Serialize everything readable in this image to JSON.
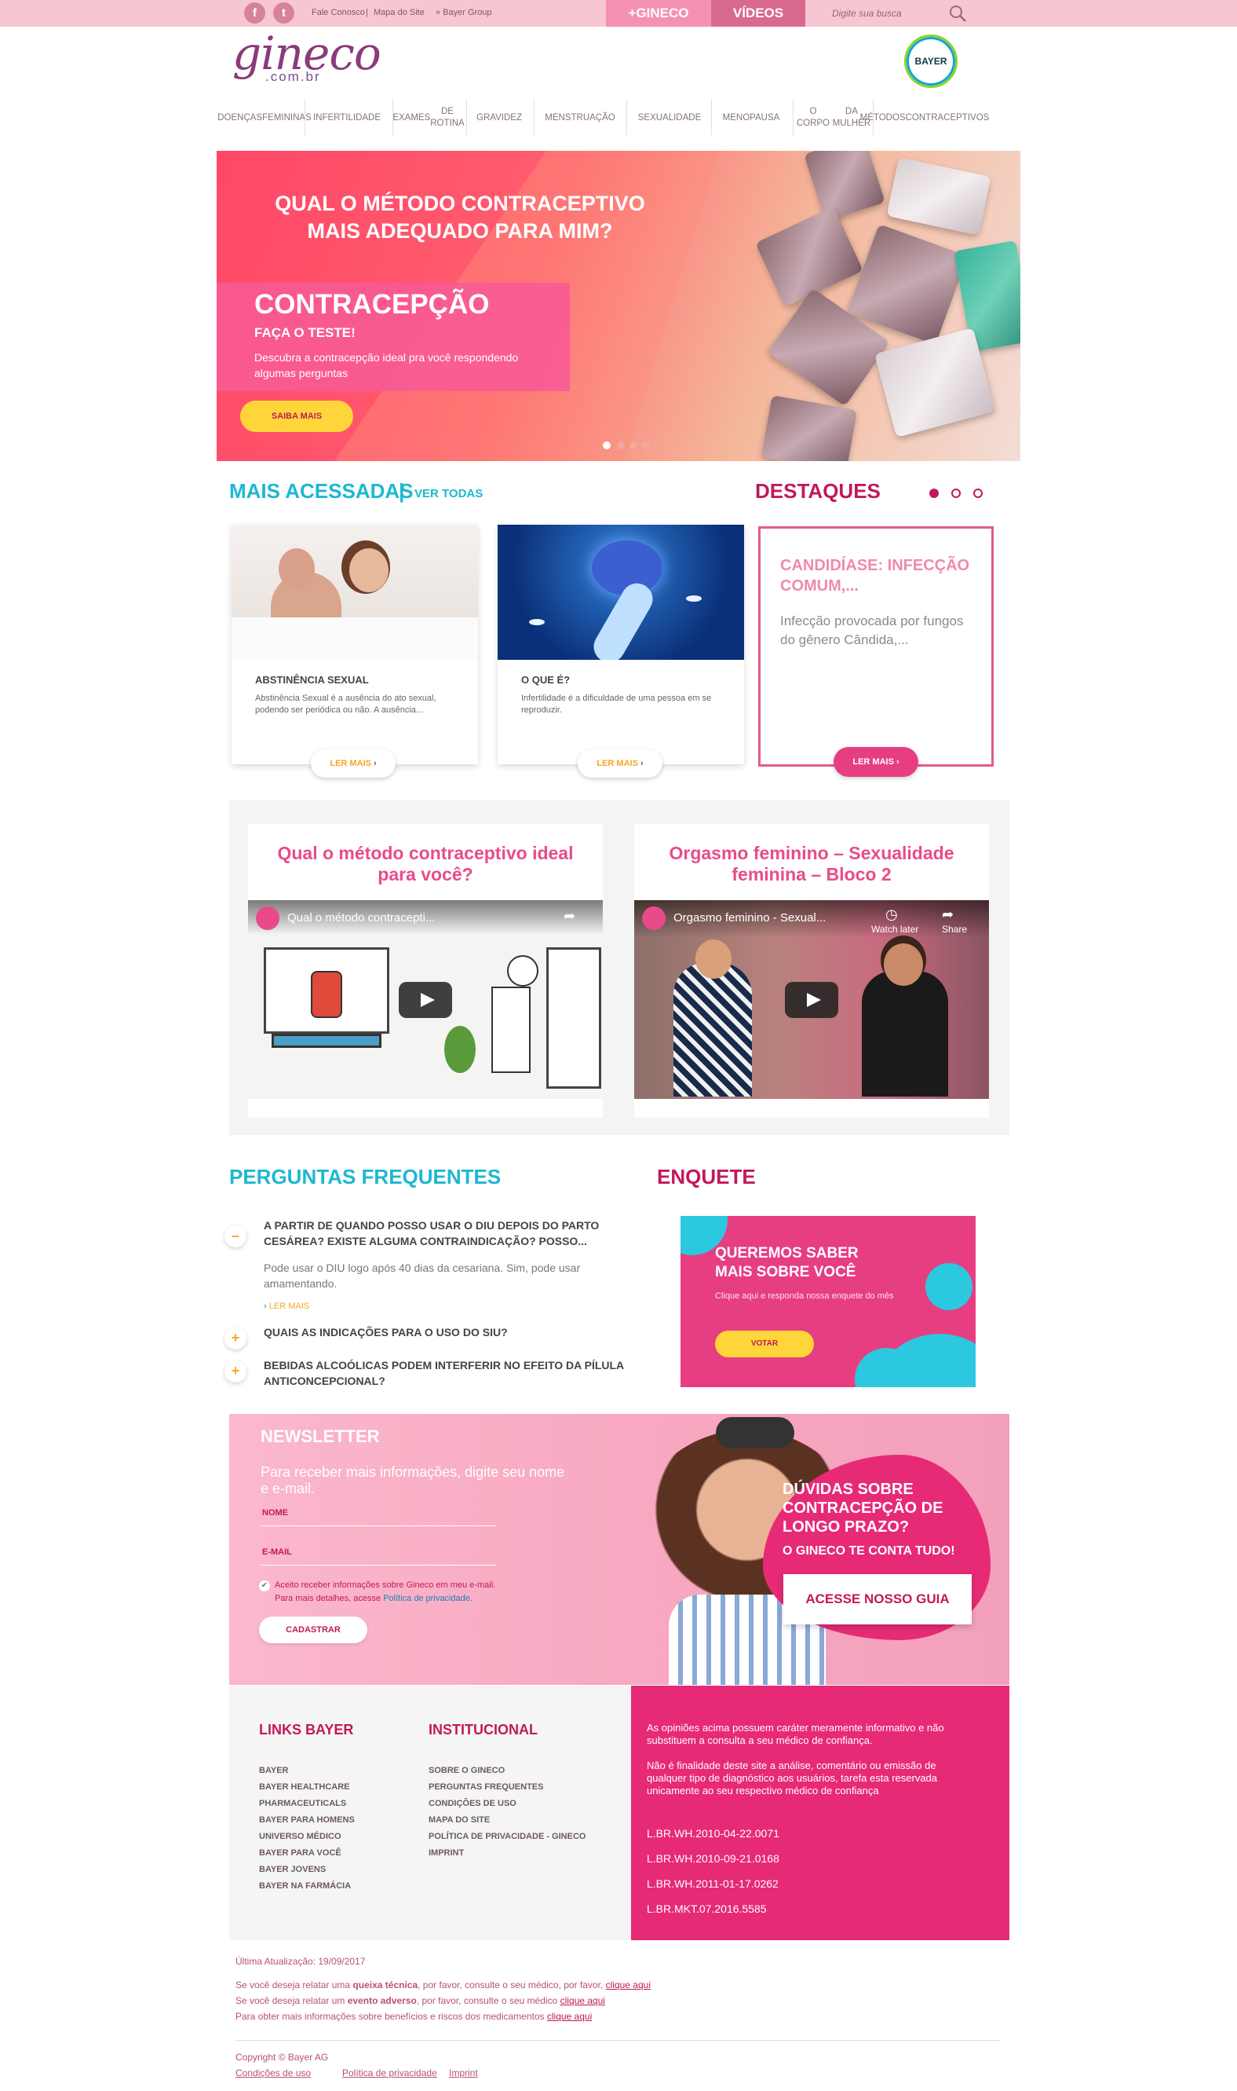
{
  "topbar": {
    "links": [
      "Fale Conosco",
      "|",
      "Mapa do Site",
      "» Bayer Group"
    ],
    "tab_gineco": "+GINECO",
    "tab_videos": "VÍDEOS",
    "search_placeholder": "Digite sua busca"
  },
  "header": {
    "logo": "gineco",
    "logo_sub": ".com.br",
    "bayer": "BAYER"
  },
  "nav": [
    [
      "DOENÇAS",
      "FEMININAS"
    ],
    [
      "INFERTILIDADE"
    ],
    [
      "EXAMES",
      "DE ROTINA"
    ],
    [
      "GRAVIDEZ"
    ],
    [
      "MENSTRUAÇÃO"
    ],
    [
      "SEXUALIDADE"
    ],
    [
      "MENOPAUSA"
    ],
    [
      "O CORPO",
      "DA MULHER"
    ],
    [
      "MÉTODOS",
      "CONTRACEPTIVOS"
    ]
  ],
  "hero": {
    "question": "QUAL O MÉTODO CONTRACEPTIVO MAIS ADEQUADO PARA MIM?",
    "title": "CONTRACEPÇÃO",
    "subtitle": "FAÇA O TESTE!",
    "desc": "Descubra a contracepção ideal pra você respondendo algumas perguntas",
    "button": "SAIBA MAIS"
  },
  "mais_acessadas": {
    "title": "MAIS ACESSADAS",
    "sep": "|",
    "ver_todas": "VER TODAS",
    "cards": [
      {
        "title": "ABSTINÊNCIA SEXUAL",
        "desc": "Abstinência Sexual é a ausência do ato sexual, podendo ser periódica ou não. A ausência...",
        "button": "LER MAIS"
      },
      {
        "title": "O QUE É?",
        "desc": "Infertilidade é a dificuldade de uma pessoa em se reproduzir.",
        "button": "LER MAIS"
      }
    ]
  },
  "destaques": {
    "title": "DESTAQUES",
    "card_title": "CANDIDÍASE: INFECÇÃO COMUM,...",
    "card_desc": "Infecção provocada por fungos do gênero Cândida,...",
    "button": "LER MAIS"
  },
  "videos": [
    {
      "title": "Qual o método contraceptivo ideal para você?",
      "player_title": "Qual o método contracepti..."
    },
    {
      "title": "Orgasmo feminino – Sexualidade feminina – Bloco 2",
      "player_title": "Orgasmo feminino - Sexual...",
      "watch_later": "Watch later",
      "share": "Share"
    }
  ],
  "faq": {
    "title": "PERGUNTAS FREQUENTES",
    "items": [
      {
        "icon": "–",
        "q": "A PARTIR DE QUANDO POSSO USAR O DIU DEPOIS DO PARTO CESÁREA? EXISTE ALGUMA CONTRAINDICAÇÃO? POSSO...",
        "a": "Pode usar o DIU  logo após 40 dias da cesariana. Sim, pode usar amamentando.",
        "link": "LER MAIS"
      },
      {
        "icon": "+",
        "q": "QUAIS AS INDICAÇÕES PARA O USO DO SIU?"
      },
      {
        "icon": "+",
        "q": "BEBIDAS ALCOÓLICAS PODEM INTERFERIR NO EFEITO DA PÍLULA ANTICONCEPCIONAL?"
      }
    ]
  },
  "enquete": {
    "title": "ENQUETE",
    "headline": "QUEREMOS SABER MAIS SOBRE VOCÊ",
    "desc": "Clique aqui e responda nossa enquete do mês",
    "button": "VOTAR"
  },
  "newsletter": {
    "title": "NEWSLETTER",
    "desc": "Para receber mais informações, digite seu nome e e-mail.",
    "name_label": "NOME",
    "email_label": "E-MAIL",
    "consent": "Aceito receber informações sobre Gineco em meu e-mail.",
    "consent2": "Para mais detalhes, acesse ",
    "privacy": "Política de privacidade.",
    "button": "CADASTRAR",
    "promo_title": "DÚVIDAS SOBRE CONTRACEPÇÃO DE LONGO PRAZO?",
    "promo_sub": "O GINECO TE CONTA TUDO!",
    "promo_button": "ACESSE NOSSO GUIA"
  },
  "footer": {
    "links_bayer_title": "LINKS BAYER",
    "links_bayer": [
      "BAYER",
      "BAYER HEALTHCARE",
      "PHARMACEUTICALS",
      "BAYER PARA HOMENS",
      "UNIVERSO MÉDICO",
      "BAYER PARA VOCÊ",
      "BAYER JOVENS",
      "BAYER NA FARMÁCIA"
    ],
    "institucional_title": "INSTITUCIONAL",
    "institucional": [
      "SOBRE O GINECO",
      "PERGUNTAS FREQUENTES",
      "CONDIÇÕES DE USO",
      "MAPA DO SITE",
      "POLÍTICA DE PRIVACIDADE - GINECO",
      "IMPRINT"
    ],
    "disclaimer1": "As opiniões acima possuem caráter meramente informativo e não substituem a consulta a seu médico de confiança.",
    "disclaimer2": "Não é finalidade deste site a análise, comentário ou emissão de qualquer tipo de diagnóstico aos usuários, tarefa esta reservada unicamente ao seu respectivo médico de confiança",
    "codes": [
      "L.BR.WH.2010-04-22.0071",
      "L.BR.WH.2010-09-21.0168",
      "L.BR.WH.2011-01-17.0262",
      "L.BR.MKT.07.2016.5585"
    ]
  },
  "bottom": {
    "updated": "Última Atualização: 19/09/2017",
    "line1_a": "Se você deseja relatar uma ",
    "line1_b": "queixa técnica",
    "line1_c": ", por favor, consulte o seu médico, por favor, ",
    "line1_link": "clique aqui",
    "line2_a": "Se você deseja relatar um ",
    "line2_b": "evento adverso",
    "line2_c": ", por favor, consulte o seu médico ",
    "line2_link": "clique aqui",
    "line3_a": "Para obter mais informações sobre benefícios e riscos dos medicamentos ",
    "line3_link": "clique aqui",
    "copyright": "Copyright © Bayer AG",
    "links": [
      "Condições de uso",
      "Política de privacidade",
      "Imprint"
    ]
  },
  "colors": {
    "pink": "#e72a76",
    "cyan": "#1cb8d0",
    "yellow": "#ffd63a",
    "magenta": "#c2185b"
  }
}
